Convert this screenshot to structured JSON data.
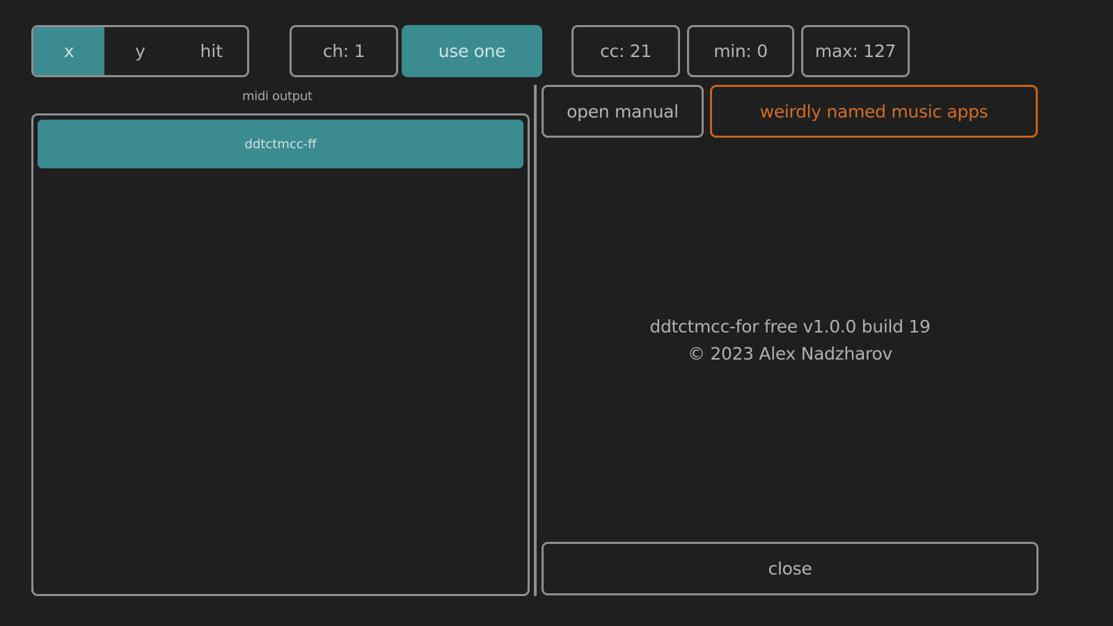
{
  "axis_selector": {
    "options": [
      "x",
      "y",
      "hit"
    ],
    "selected": "x"
  },
  "channel_label": "ch: 1",
  "use_one_label": "use one",
  "cc_label": "cc: 21",
  "min_label": "min: 0",
  "max_label": "max: 127",
  "midi_output": {
    "heading": "midi output",
    "devices": [
      "ddtctmcc-ff"
    ],
    "selected": "ddtctmcc-ff"
  },
  "open_manual_label": "open manual",
  "apps_link_label": "weirdly named music apps",
  "about": {
    "version_line": "ddtctmcc-for free v1.0.0 build 19",
    "copyright_line": "© 2023 Alex Nadzharov"
  },
  "close_label": "close",
  "colors": {
    "background": "#1f1f1f",
    "accent": "#3a8c91",
    "border": "#8e8e8e",
    "link_orange": "#d36d25"
  }
}
